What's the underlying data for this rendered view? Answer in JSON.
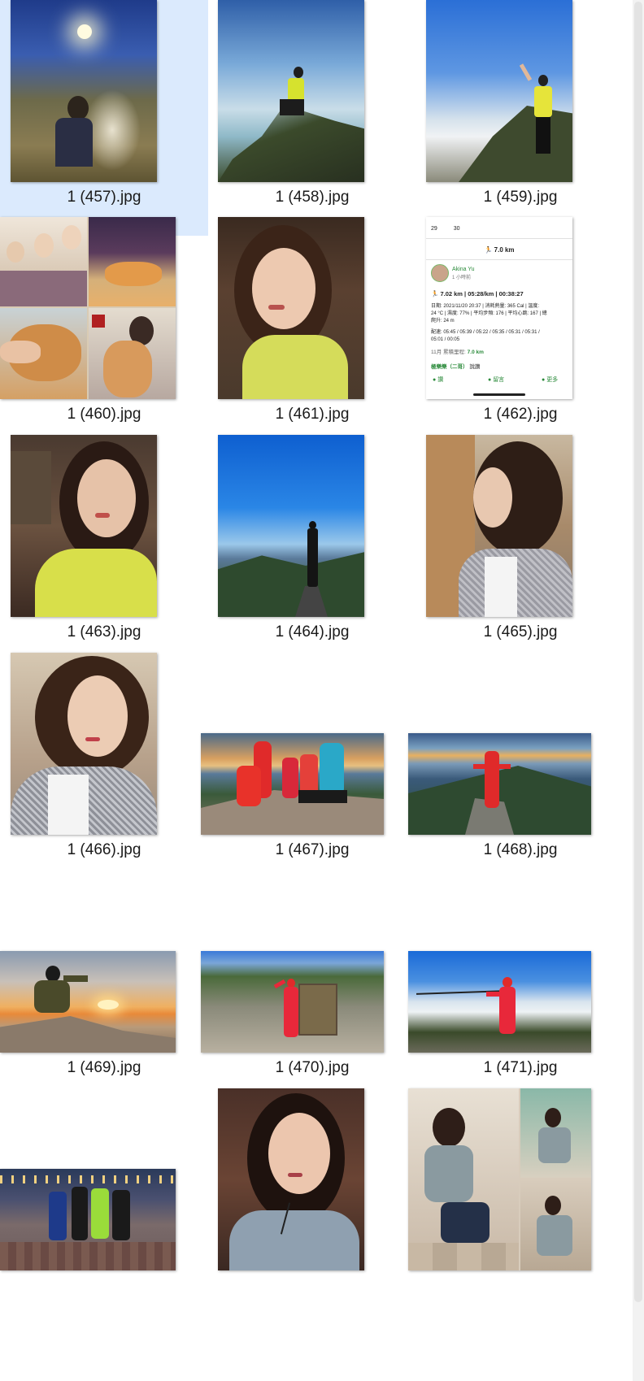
{
  "files": [
    {
      "name": "1 (457).jpg",
      "selected": true
    },
    {
      "name": "1 (458).jpg"
    },
    {
      "name": "1 (459).jpg"
    },
    {
      "name": "1 (460).jpg"
    },
    {
      "name": "1 (461).jpg"
    },
    {
      "name": "1 (462).jpg"
    },
    {
      "name": "1 (463).jpg"
    },
    {
      "name": "1 (464).jpg"
    },
    {
      "name": "1 (465).jpg"
    },
    {
      "name": "1 (466).jpg"
    },
    {
      "name": "1 (467).jpg"
    },
    {
      "name": "1 (468).jpg"
    },
    {
      "name": "1 (469).jpg"
    },
    {
      "name": "1 (470).jpg"
    },
    {
      "name": "1 (471).jpg"
    },
    {
      "name": ""
    },
    {
      "name": ""
    },
    {
      "name": ""
    }
  ],
  "activity_card": {
    "dates": [
      "29",
      "30"
    ],
    "distance_header": "7.0 km",
    "user_name": "Akina Yu",
    "posted_ago": "1 小時前",
    "summary": "7.02 km | 05:28/km | 00:38:27",
    "detail_1": "日期: 2021/11/20 20:37 | 消耗熱量: 365 Cal | 溫度:",
    "detail_2": "24 °C | 濕度: 77% | 平均步頻: 176 | 平均心跳: 167 | 總",
    "detail_3": "爬升: 24 m",
    "splits_1": "配速: 05:45 / 05:39 / 05:22 / 05:35 / 05:31 / 05:31 /",
    "splits_2": "05:01 / 00:05",
    "month_label": "11月 累積里程:",
    "month_total": "7.0 km",
    "group_name": "極樂樂（二哥）",
    "group_suffix": "說讚",
    "action_like": "讚",
    "action_comment": "留言",
    "action_more": "更多"
  },
  "colors": {
    "selection": "#dbeafd",
    "accent_green": "#2a8a3a"
  }
}
